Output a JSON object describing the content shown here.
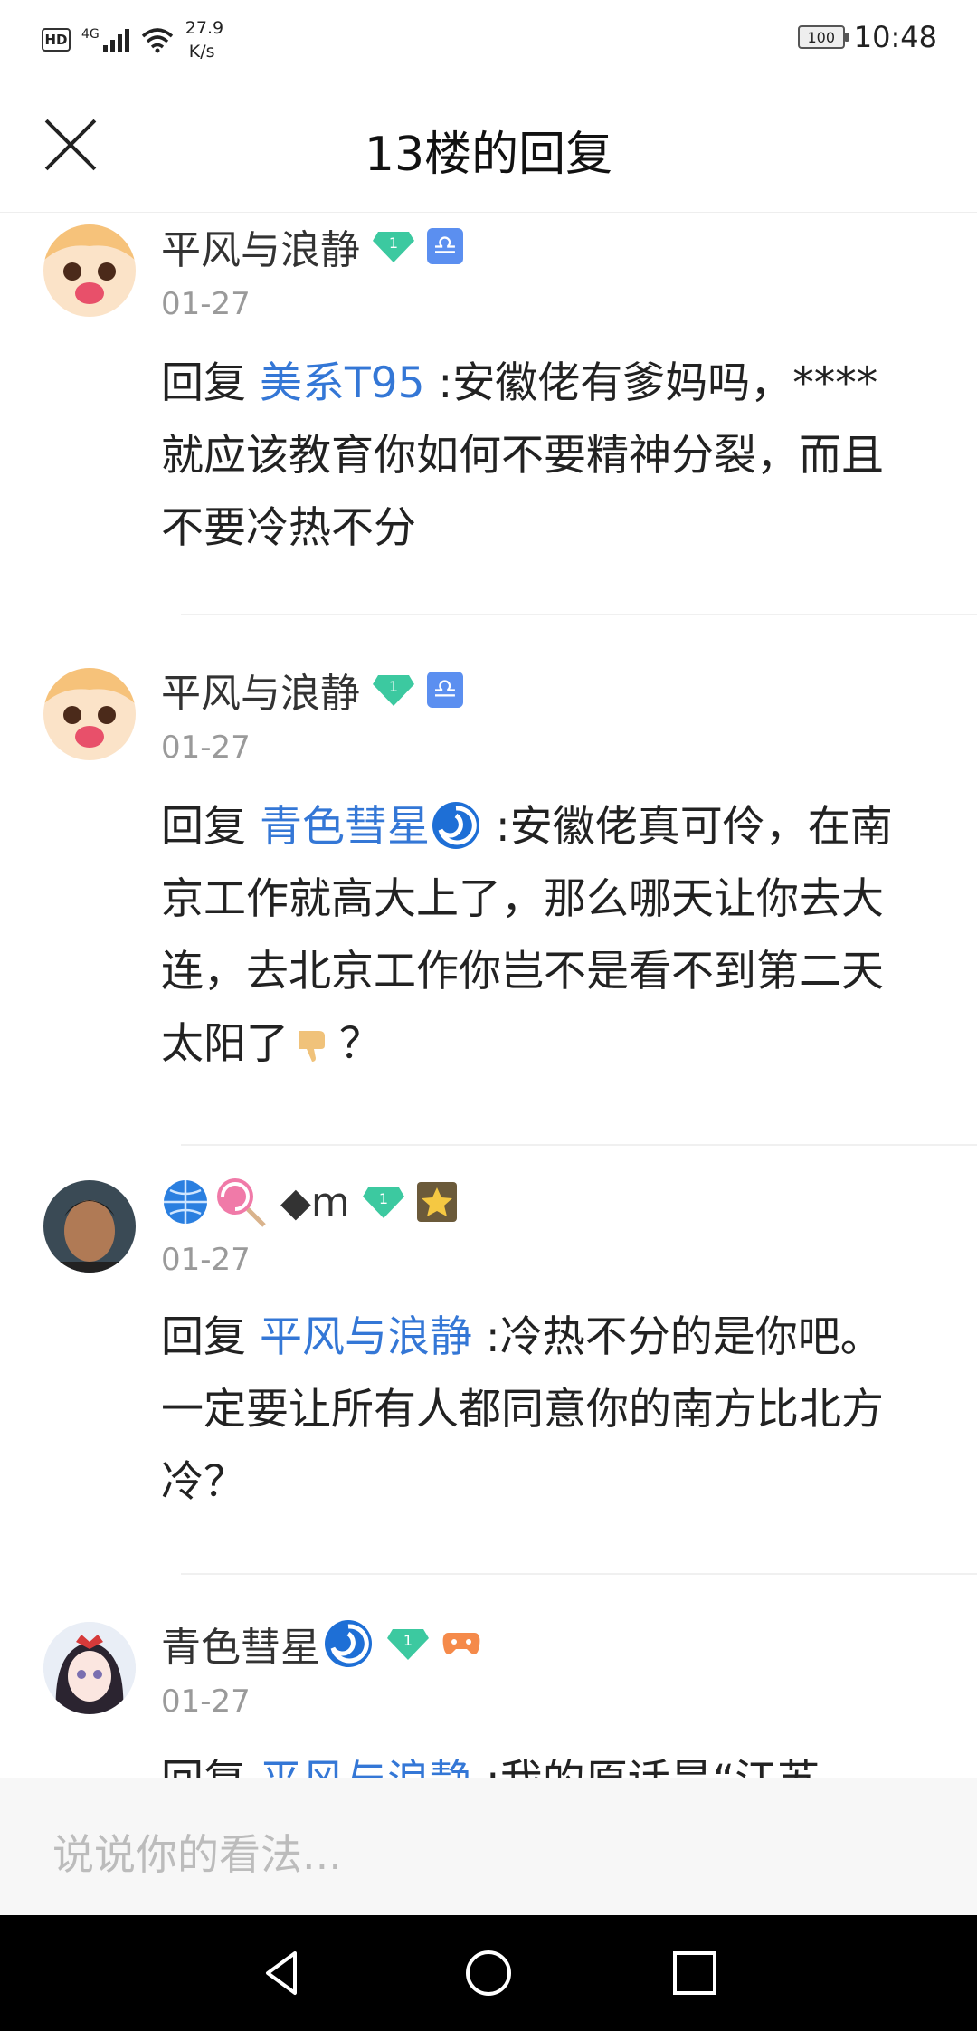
{
  "status_bar": {
    "hd": "HD",
    "network": "4G",
    "speed_value": "27.9",
    "speed_unit": "K/s",
    "battery": "100",
    "time": "10:48"
  },
  "header": {
    "title": "13楼的回复"
  },
  "replies": [
    {
      "username": "平风与浪静",
      "date": "01-27",
      "prefix": "回复 ",
      "mention": "美系T95",
      "text": " :安徽佬有爹妈吗，****就应该教育你如何不要精神分裂，而且不要冷热不分"
    },
    {
      "username": "平风与浪静",
      "date": "01-27",
      "prefix": "回复 ",
      "mention": "青色彗星",
      "text": " :安徽佬真可伶，在南京工作就高大上了，那么哪天让你去大连，去北京工作你岂不是看不到第二天太阳了",
      "suffix": "？"
    },
    {
      "username": "◆m",
      "date": "01-27",
      "prefix": "回复 ",
      "mention": "平风与浪静",
      "text": " :冷热不分的是你吧。一定要让所有人都同意你的南方比北方冷？"
    },
    {
      "username": "青色彗星",
      "date": "01-27",
      "prefix": "回复 ",
      "mention": "平风与浪静",
      "text": " :我的原话是“江苏"
    }
  ],
  "input": {
    "placeholder": "说说你的看法..."
  },
  "badge_level": "1",
  "colors": {
    "mention": "#3477d6",
    "gem": "#3cc9a0",
    "zodiac": "#5b8ff0"
  }
}
